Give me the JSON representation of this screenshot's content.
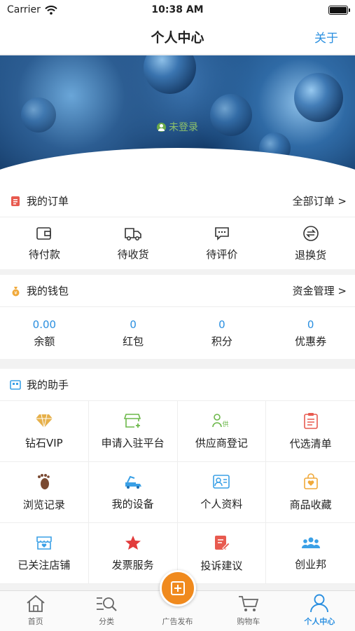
{
  "status_bar": {
    "carrier": "Carrier",
    "time": "10:38 AM"
  },
  "navbar": {
    "title": "个人中心",
    "about": "关于"
  },
  "banner": {
    "login_text": "未登录"
  },
  "orders": {
    "title": "我的订单",
    "all_link": "全部订单 >",
    "items": [
      {
        "label": "待付款",
        "icon": "wallet-icon"
      },
      {
        "label": "待收货",
        "icon": "truck-icon"
      },
      {
        "label": "待评价",
        "icon": "comment-icon"
      },
      {
        "label": "退换货",
        "icon": "exchange-icon"
      }
    ]
  },
  "wallet": {
    "title": "我的钱包",
    "manage_link": "资金管理 >",
    "items": [
      {
        "value": "0.00",
        "label": "余额"
      },
      {
        "value": "0",
        "label": "红包"
      },
      {
        "value": "0",
        "label": "积分"
      },
      {
        "value": "0",
        "label": "优惠券"
      }
    ]
  },
  "assistant": {
    "title": "我的助手",
    "items": [
      {
        "label": "钻石VIP",
        "icon": "diamond-icon"
      },
      {
        "label": "申请入驻平台",
        "icon": "store-add-icon"
      },
      {
        "label": "供应商登记",
        "icon": "supplier-icon"
      },
      {
        "label": "代选清单",
        "icon": "list-icon"
      },
      {
        "label": "浏览记录",
        "icon": "footprint-icon"
      },
      {
        "label": "我的设备",
        "icon": "device-icon"
      },
      {
        "label": "个人资料",
        "icon": "profile-card-icon"
      },
      {
        "label": "商品收藏",
        "icon": "favorite-bag-icon"
      },
      {
        "label": "已关注店铺",
        "icon": "followed-store-icon"
      },
      {
        "label": "发票服务",
        "icon": "star-icon"
      },
      {
        "label": "投诉建议",
        "icon": "complaint-icon"
      },
      {
        "label": "创业邦",
        "icon": "team-icon"
      }
    ]
  },
  "tabbar": {
    "items": [
      {
        "label": "首页",
        "icon": "home-icon"
      },
      {
        "label": "分类",
        "icon": "category-search-icon"
      },
      {
        "label": "广告发布",
        "icon": "ad-publish-icon"
      },
      {
        "label": "购物车",
        "icon": "cart-icon"
      },
      {
        "label": "个人中心",
        "icon": "user-icon"
      }
    ]
  },
  "colors": {
    "accent": "#2a8fe0",
    "fab": "#f08a1e",
    "login": "#8dc06a"
  }
}
